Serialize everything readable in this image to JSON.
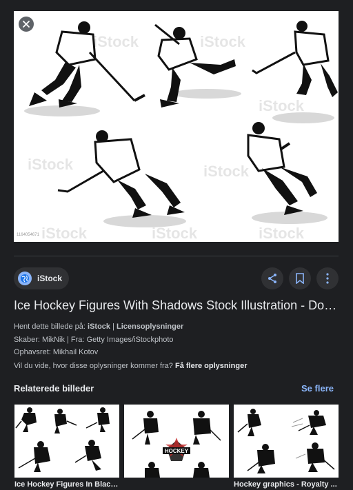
{
  "hero": {
    "watermark": "iStock",
    "image_id": "1164054671"
  },
  "source": {
    "name": "iStock"
  },
  "title": "Ice Hockey Figures With Shadows Stock Illustration - Download Image Now",
  "meta": {
    "get_label": "Hent dette billede på:",
    "get_source": "iStock",
    "get_sep": "|",
    "license_link": "Licensoplysninger",
    "creator_line": "Skaber: MikNik | Fra: Getty Images/iStockphoto",
    "copyright_line": "Ophavsret: Mikhail Kotov",
    "info_question": "Vil du vide, hvor disse oplysninger kommer fra?",
    "info_link": "Få flere oplysninger"
  },
  "related": {
    "heading": "Relaterede billeder",
    "see_more": "Se flere",
    "items": [
      {
        "caption": "Ice Hockey Figures In Black ..."
      },
      {
        "caption": ""
      },
      {
        "caption": "Hockey graphics - Royalty ..."
      }
    ],
    "badge": "HOCKEY"
  },
  "colors": {
    "background": "#1e1f22",
    "accent": "#8ab4f8",
    "chip": "#303134"
  }
}
